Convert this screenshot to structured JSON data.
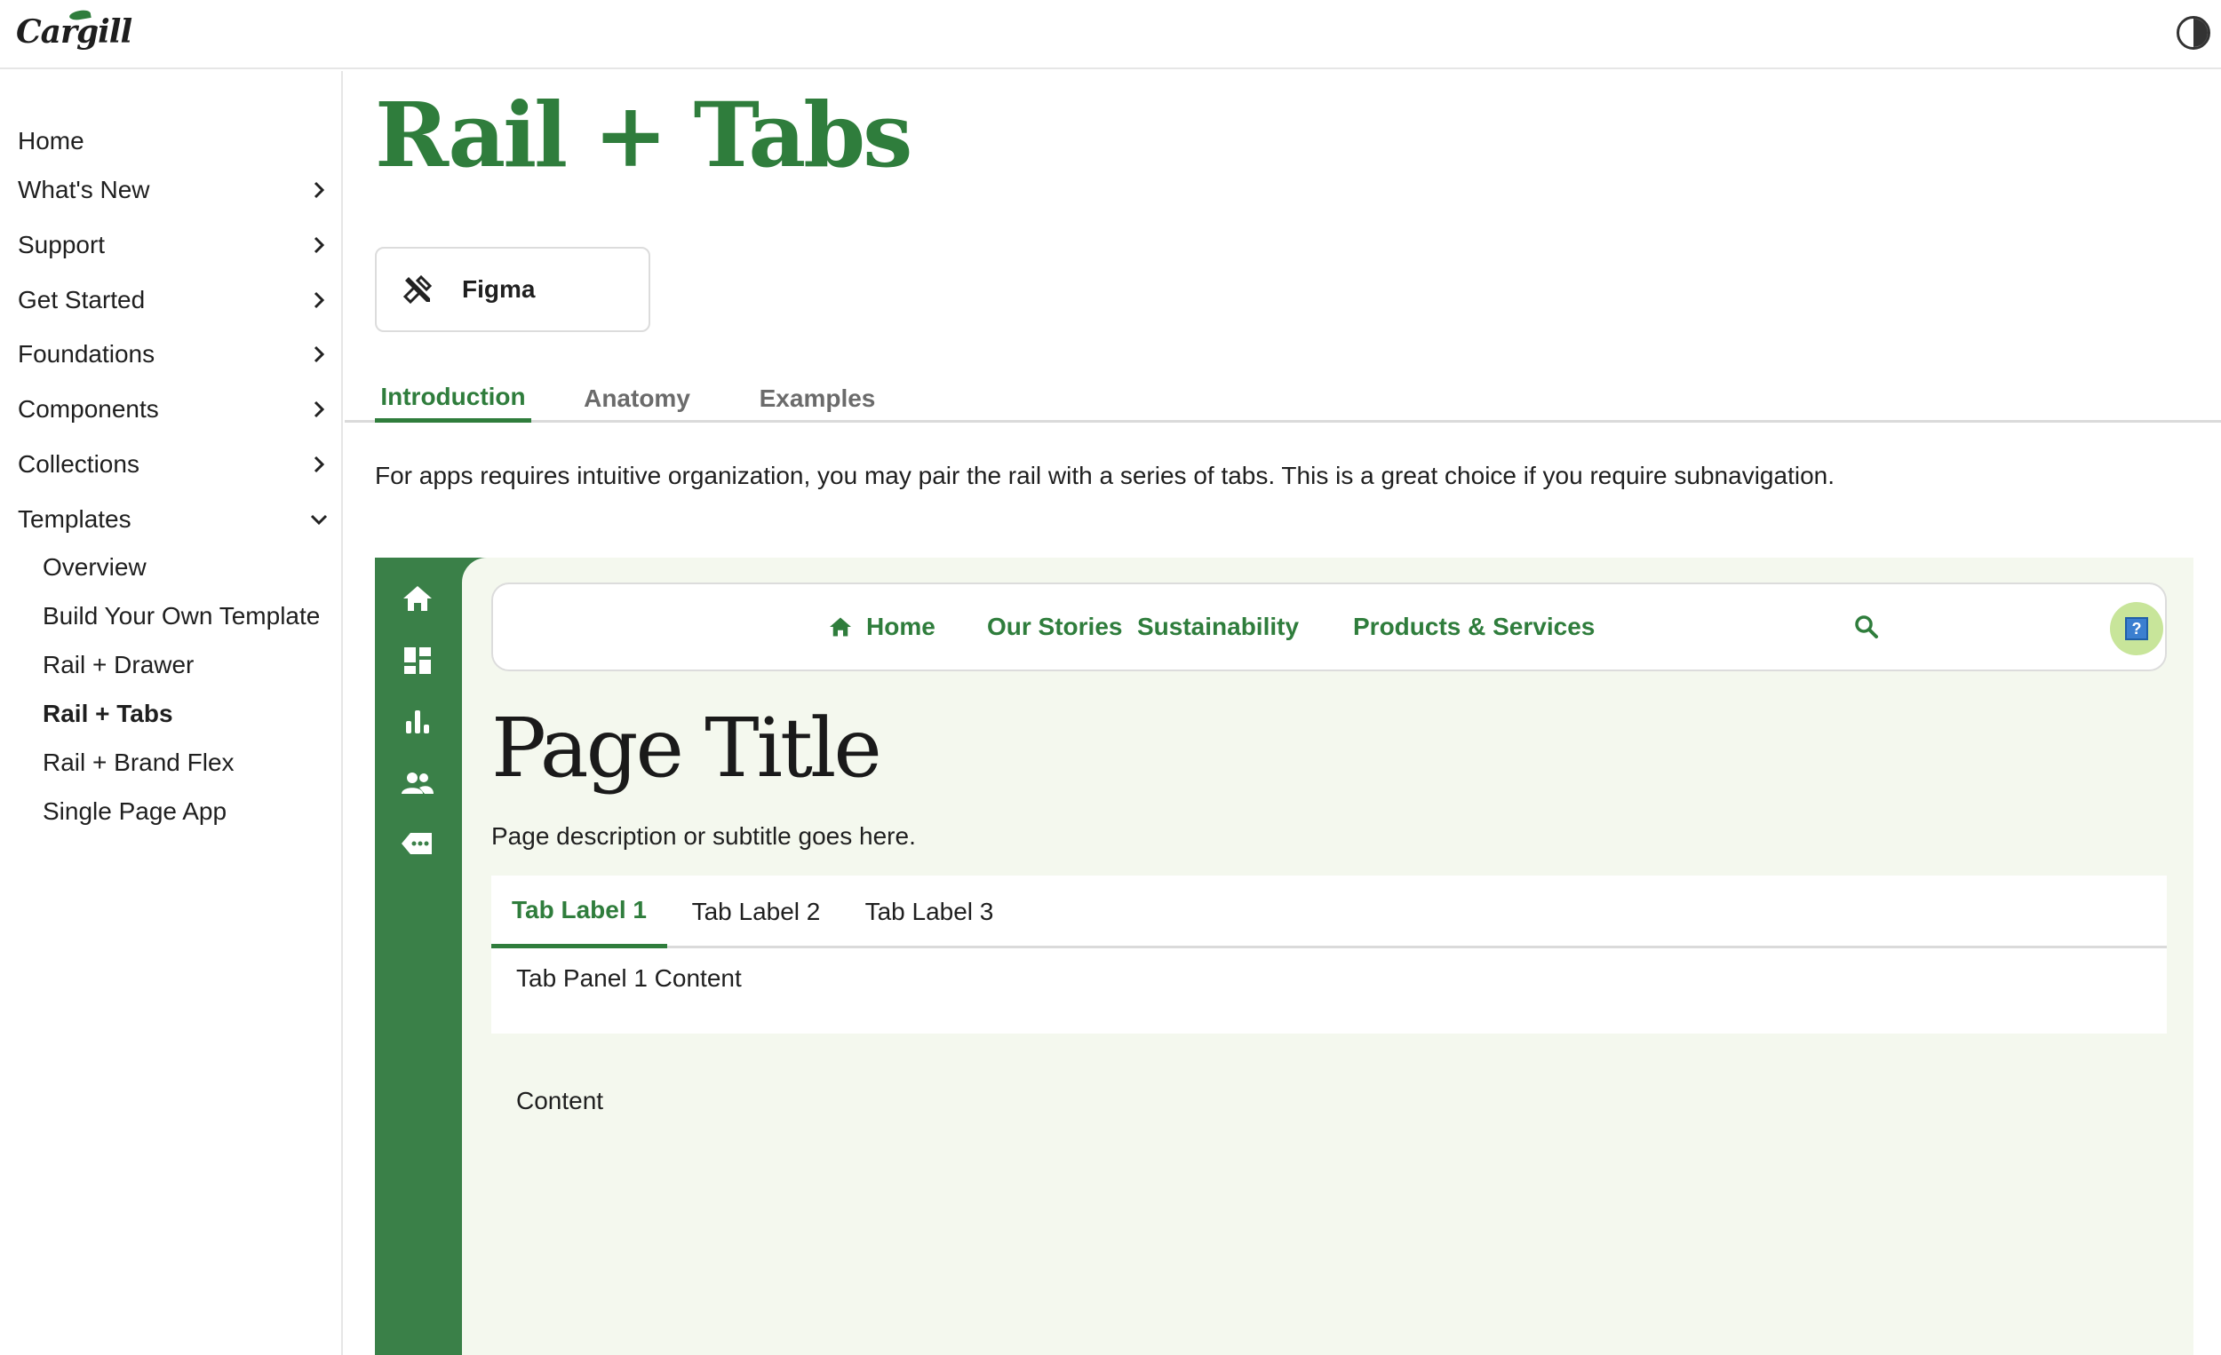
{
  "header": {
    "logo_text": "Cargill"
  },
  "sidebar": {
    "items": [
      {
        "label": "Home"
      },
      {
        "label": "What's New"
      },
      {
        "label": "Support"
      },
      {
        "label": "Get Started"
      },
      {
        "label": "Foundations"
      },
      {
        "label": "Components"
      },
      {
        "label": "Collections"
      },
      {
        "label": "Templates"
      }
    ],
    "sub_items": [
      {
        "label": "Overview"
      },
      {
        "label": "Build Your Own Template"
      },
      {
        "label": "Rail + Drawer"
      },
      {
        "label": "Rail + Tabs",
        "active": true
      },
      {
        "label": "Rail + Brand Flex"
      },
      {
        "label": "Single Page App"
      }
    ]
  },
  "main": {
    "title": "Rail + Tabs",
    "figma_button": "Figma",
    "tabs": [
      {
        "label": "Introduction",
        "active": true
      },
      {
        "label": "Anatomy"
      },
      {
        "label": "Examples"
      }
    ],
    "intro": "For apps requires intuitive organization, you may pair the rail with a series of tabs. This is a great choice if you require subnavigation."
  },
  "demo": {
    "nav": [
      "Home",
      "Our Stories",
      "Sustainability",
      "Products & Services"
    ],
    "avatar_glyph": "?",
    "page_title": "Page Title",
    "page_subtitle": "Page description or subtitle goes here.",
    "tabs": [
      {
        "label": "Tab Label 1",
        "active": true
      },
      {
        "label": "Tab Label 2"
      },
      {
        "label": "Tab Label 3"
      }
    ],
    "tab_panel": "Tab Panel 1 Content",
    "content": "Content"
  },
  "colors": {
    "brand_green": "#2f7d3c",
    "rail_green": "#3a8048",
    "demo_bg": "#f4f8ee"
  }
}
